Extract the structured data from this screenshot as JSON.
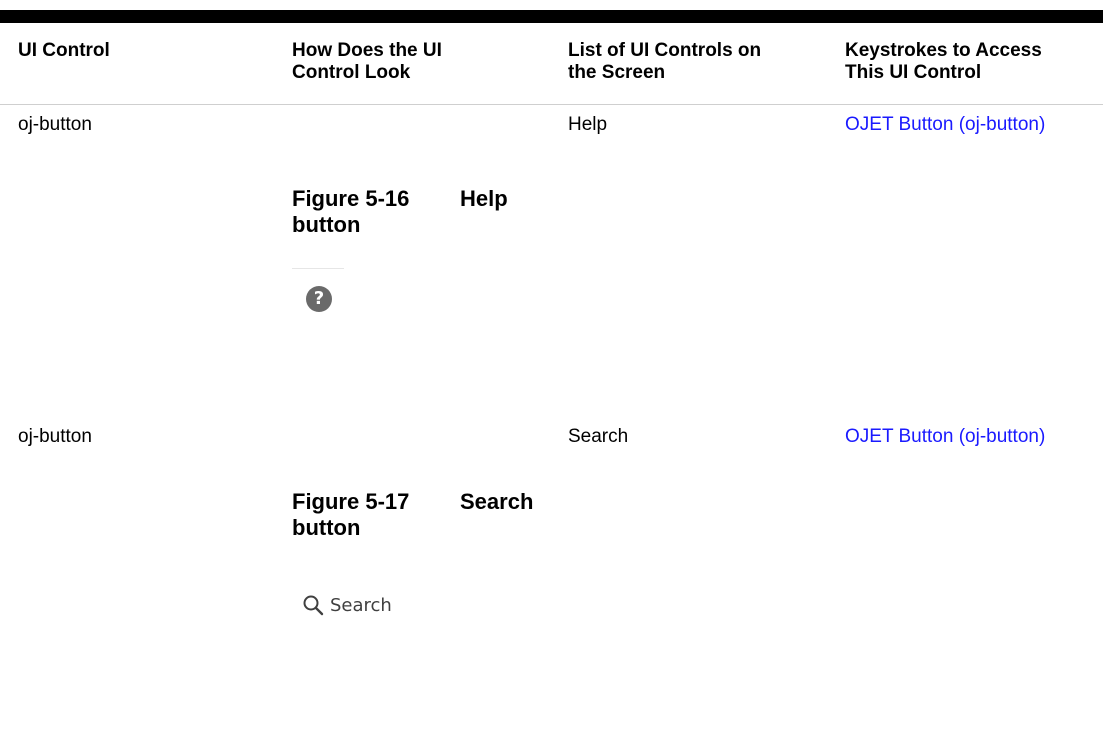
{
  "table": {
    "headers": {
      "ui_control": "UI Control",
      "look_line1": "How Does the UI",
      "look_line2": "Control Look",
      "list_line1": "List of UI Controls on",
      "list_line2": "the Screen",
      "keys_line1": "Keystrokes to Access",
      "keys_line2": "This UI Control"
    },
    "rows": [
      {
        "control": "oj-button",
        "figure_number": "Figure 5-16",
        "figure_title_word": "Help",
        "figure_title_rest": "button",
        "icon": "help-icon",
        "icon_glyph": "?",
        "list_value": "Help",
        "link": "OJET Button (oj-button)"
      },
      {
        "control": "oj-button",
        "figure_number": "Figure 5-17",
        "figure_title_word": "Search",
        "figure_title_rest": "button",
        "icon": "search-icon",
        "button_label": "Search",
        "list_value": "Search",
        "link": "OJET Button (oj-button)"
      }
    ]
  },
  "colors": {
    "link": "#1a1aff",
    "help_icon_bg": "#6a6a6a",
    "search_icon": "#404040"
  }
}
